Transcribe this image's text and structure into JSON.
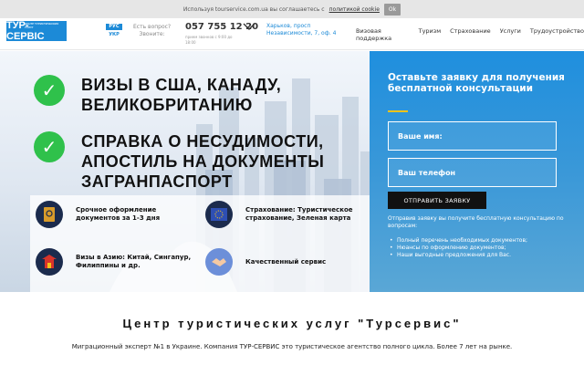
{
  "cookie": {
    "text": "Используя tourservice.com.ua вы соглашаетесь с",
    "link": "политикой cookie",
    "ok": "Ok"
  },
  "header": {
    "logo": "ТУР-СЕРВІС",
    "logo_sub": "ЦЕНТР ТУРИСТИЧЕСКИХ УСЛУГ",
    "lang_active": "РУС",
    "lang_other": "УКР",
    "question_line1": "Есть вопрос?",
    "question_line2": "Звоните:",
    "phone": "057 755 12 20",
    "hours": "прием звонков с 9:00 до",
    "hours2": "18:00",
    "address_line1": "Харьков, просп",
    "address_line2": "Независимости, 7, оф. 4",
    "nav": [
      "Визовая поддержка",
      "Туризм",
      "Страхование",
      "Услуги",
      "Трудоустройство"
    ]
  },
  "hero": {
    "title1": "ВИЗЫ В США, КАНАДУ, ВЕЛИКОБРИТАНИЮ",
    "title2": "СПРАВКА О НЕСУДИМОСТИ, АПОСТИЛЬ НА ДОКУМЕНТЫ ЗАГРАНПАСПОРТ",
    "features": [
      "Срочное оформление документов за 1-3 дня",
      "Страхование: Туристическое страхование, Зеленая карта",
      "Визы в Азию: Китай, Сингапур, Филиппины и др.",
      "Качественный сервис"
    ]
  },
  "form": {
    "title": "Оставьте заявку для получения бесплатной консультации",
    "name_placeholder": "Ваше имя:",
    "phone_placeholder": "Ваш телефон",
    "submit": "ОТПРАВИТЬ ЗАЯВКУ",
    "note": "Отправив заявку вы получите бесплатную консультацию по вопросам:",
    "list": [
      "Полный перечень необходимых документов;",
      "Нюансы по оформлению документов;",
      "Наши выгодные предложения для Вас."
    ]
  },
  "about": {
    "title": "Центр туристических услуг \"Турсервис\"",
    "text": "Миграционный эксперт №1 в Украине. Компания ТУР-СЕРВИС это туристическое агентство полного цикла. Более 7 лет на рынке."
  },
  "colors": {
    "brand": "#1c8ad7",
    "check": "#2fc14b",
    "accent": "#f5c31a"
  }
}
